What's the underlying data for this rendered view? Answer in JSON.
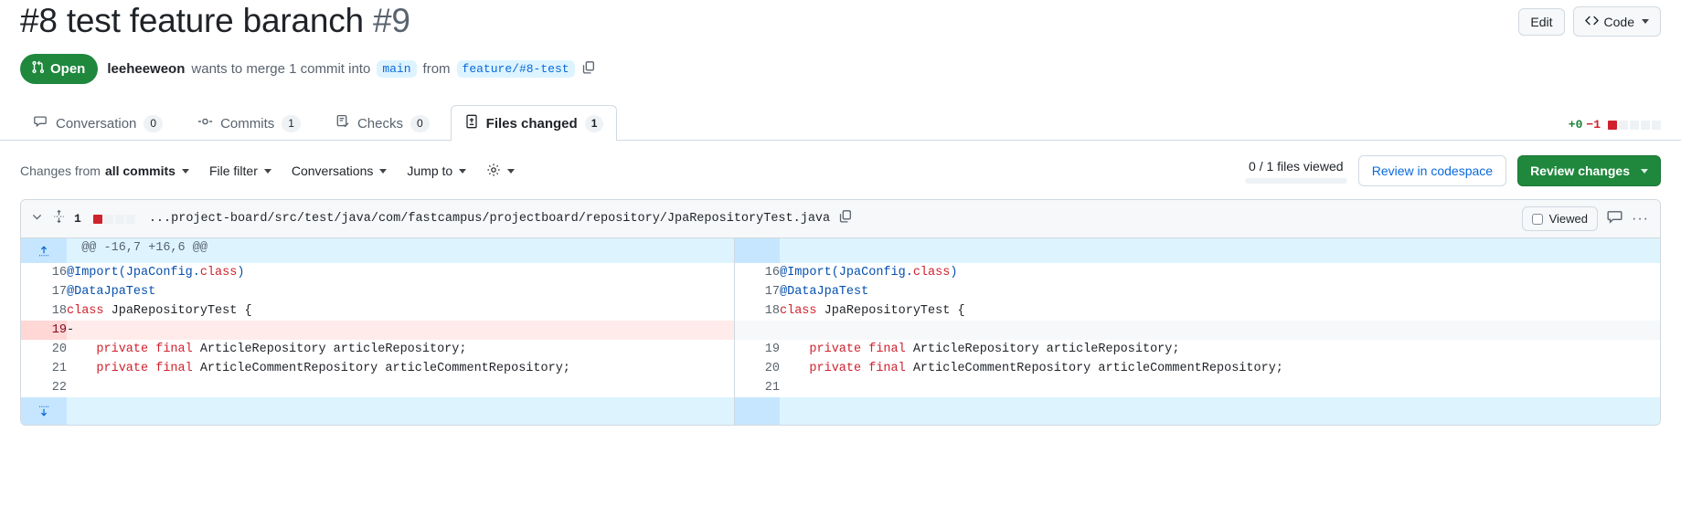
{
  "header": {
    "title": "#8 test feature baranch",
    "number": "#9",
    "edit_label": "Edit",
    "code_label": "Code"
  },
  "status": {
    "state_label": "Open",
    "author": "leeheeweon",
    "text_wants": "wants to merge 1 commit into",
    "base_branch": "main",
    "text_from": "from",
    "head_branch": "feature/#8-test"
  },
  "tabs": [
    {
      "label": "Conversation",
      "count": "0",
      "icon": "comment-icon",
      "selected": false
    },
    {
      "label": "Commits",
      "count": "1",
      "icon": "commit-icon",
      "selected": false
    },
    {
      "label": "Checks",
      "count": "0",
      "icon": "checklist-icon",
      "selected": false
    },
    {
      "label": "Files changed",
      "count": "1",
      "icon": "file-diff-icon",
      "selected": true
    }
  ],
  "diffstat": {
    "additions": "+0",
    "deletions": "−1",
    "blocks": [
      "del",
      "empty",
      "empty",
      "empty",
      "empty"
    ]
  },
  "toolbar": {
    "changes_from_prefix": "Changes from",
    "changes_from_value": "all commits",
    "file_filter": "File filter",
    "conversations": "Conversations",
    "jump_to": "Jump to",
    "settings_icon": "gear-icon",
    "files_viewed": "0 / 1 files viewed",
    "progress_percent": 0,
    "review_codespace": "Review in codespace",
    "review_changes": "Review changes"
  },
  "file": {
    "change_count": "1",
    "path": "...project-board/src/test/java/com/fastcampus/projectboard/repository/JpaRepositoryTest.java",
    "blocks": [
      "del",
      "empty",
      "empty",
      "empty"
    ],
    "viewed_label": "Viewed",
    "copy_icon": "copy-icon",
    "comment_icon": "comment-icon",
    "kebab_label": "···"
  },
  "diff": {
    "hunk_header": "@@ -16,7 +16,6 @@",
    "expand_up_icon": "expand-up-icon",
    "expand_down_icon": "expand-down-icon",
    "rows": [
      {
        "type": "ctx",
        "left_num": "16",
        "right_num": "16",
        "tokens": [
          {
            "t": "@Import(JpaConfig.",
            "c": "ann"
          },
          {
            "t": "class",
            "c": "kw"
          },
          {
            "t": ")",
            "c": "ann"
          }
        ]
      },
      {
        "type": "ctx",
        "left_num": "17",
        "right_num": "17",
        "tokens": [
          {
            "t": "@DataJpaTest",
            "c": "ann"
          }
        ]
      },
      {
        "type": "ctx",
        "left_num": "18",
        "right_num": "18",
        "tokens": [
          {
            "t": "class",
            "c": "kw"
          },
          {
            "t": " JpaRepositoryTest {",
            "c": "id"
          }
        ]
      },
      {
        "type": "del",
        "left_num": "19",
        "right_num": "",
        "marker": "-",
        "tokens": []
      },
      {
        "type": "ctx",
        "left_num": "20",
        "right_num": "19",
        "tokens": [
          {
            "t": "    ",
            "c": "id"
          },
          {
            "t": "private final",
            "c": "kw"
          },
          {
            "t": " ArticleRepository articleRepository;",
            "c": "id"
          }
        ]
      },
      {
        "type": "ctx",
        "left_num": "21",
        "right_num": "20",
        "tokens": [
          {
            "t": "    ",
            "c": "id"
          },
          {
            "t": "private final",
            "c": "kw"
          },
          {
            "t": " ArticleCommentRepository articleCommentRepository;",
            "c": "id"
          }
        ]
      },
      {
        "type": "ctx",
        "left_num": "22",
        "right_num": "21",
        "tokens": []
      }
    ]
  }
}
